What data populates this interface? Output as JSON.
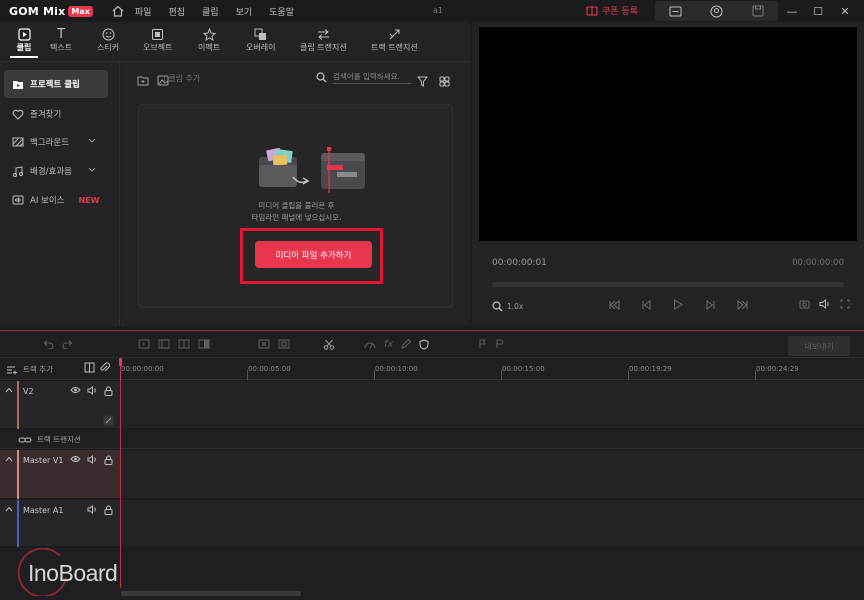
{
  "titlebar": {
    "logo": "GOM Mix",
    "logo_badge": "Max",
    "menu": [
      "파일",
      "편집",
      "클립",
      "보기",
      "도움말"
    ],
    "project_name": "a1",
    "coupon": "쿠폰 등록",
    "window_controls": [
      "minimize-icon",
      "maximize-icon",
      "close-icon"
    ]
  },
  "tool_tabs": [
    {
      "label": "클립",
      "icon": "clip-icon",
      "active": true
    },
    {
      "label": "텍스트",
      "icon": "text-icon"
    },
    {
      "label": "스티커",
      "icon": "sticker-icon"
    },
    {
      "label": "오브젝트",
      "icon": "object-icon"
    },
    {
      "label": "이펙트",
      "icon": "effect-icon"
    },
    {
      "label": "오버레이",
      "icon": "overlay-icon"
    },
    {
      "label": "클립 트랜지션",
      "icon": "clip-transition-icon"
    },
    {
      "label": "트랙 트랜지션",
      "icon": "track-transition-icon"
    }
  ],
  "sidebar": {
    "items": [
      {
        "label": "프로젝트 클립",
        "icon": "project-clip-icon",
        "active": true
      },
      {
        "label": "즐겨찾기",
        "icon": "heart-icon"
      },
      {
        "label": "백그라운드",
        "icon": "background-icon",
        "expandable": true
      },
      {
        "label": "배경/효과음",
        "icon": "music-note-icon",
        "expandable": true
      },
      {
        "label": "AI 보이스",
        "icon": "ai-voice-icon",
        "badge": "NEW"
      }
    ]
  },
  "media": {
    "clip_add": "| 클립 추가",
    "search_placeholder": "검색어를 입력하세요.",
    "empty_line1": "미디어 클립을 불러온 후",
    "empty_line2": "타임라인 패널에 넣으십시오.",
    "add_button": "미디어 파일 추가하기"
  },
  "preview": {
    "current_time": "00:00:00:01",
    "total_time": "00:00:00:00",
    "zoom": "1.0x"
  },
  "timeline": {
    "export_button": "내보내기",
    "track_add": "트랙 추가",
    "ruler_labels": [
      "00:00:00:00",
      "00:00:05:00",
      "00:00:10:00",
      "00:00:15:00",
      "00:00:19:29",
      "00:00:24:29"
    ],
    "tracks": [
      {
        "name": "V2",
        "color": "#b86a5a"
      },
      {
        "name": "Master V1",
        "color": "#d98a80"
      },
      {
        "name": "Master A1",
        "color": "#5a5ab8"
      }
    ],
    "track_transition": "트랙 트랜지션"
  },
  "watermark": "InoBoard",
  "colors": {
    "accent": "#e8364f",
    "highlight_frame": "#e01b2f",
    "background": "#1c1c1e",
    "panel": "#232325"
  }
}
